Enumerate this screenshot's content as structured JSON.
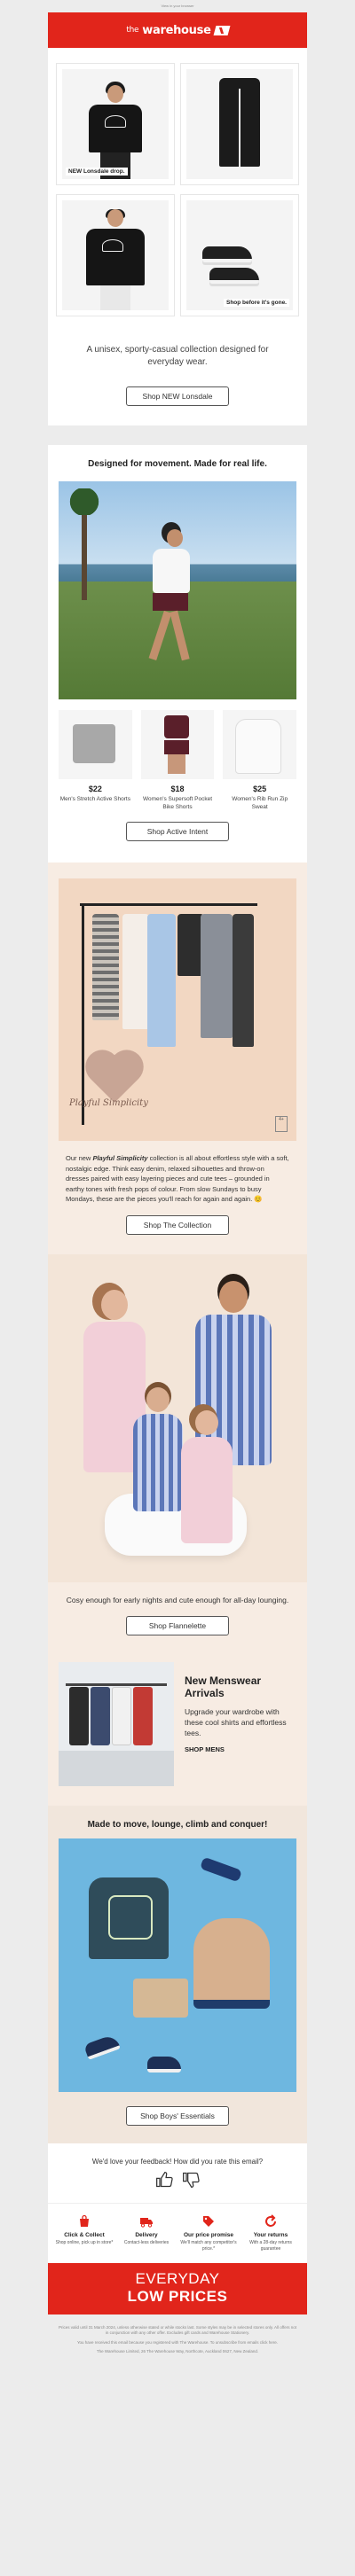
{
  "preheader": "View in your browser",
  "brand": {
    "name_the": "the",
    "name_main": "warehouse",
    "accent": "#e1251b"
  },
  "hero_grid": {
    "captions": [
      "NEW Lonsdale drop.",
      "Shop before it's gone."
    ],
    "tee_print": "LONSDALE"
  },
  "lonsdale": {
    "intro": "A unisex, sporty-casual collection designed for everyday wear.",
    "button": "Shop NEW Lonsdale"
  },
  "active": {
    "title": "Designed for movement. Made for real life.",
    "products": [
      {
        "price": "$22",
        "name": "Men's Stretch Active Shorts"
      },
      {
        "price": "$18",
        "name": "Women's Supersoft Pocket Bike Shorts"
      },
      {
        "price": "$25",
        "name": "Women's Rib Run Zip Sweat"
      }
    ],
    "button": "Shop Active Intent"
  },
  "playful": {
    "heart_text": "Playful Simplicity",
    "para_pre": "Our new ",
    "para_em": "Playful Simplicity",
    "para_post": " collection is all about effortless style with a soft, nostalgic edge. Think easy denim, relaxed silhouettes and throw-on dresses paired with easy layering pieces and cute tees – grounded in earthy tones with fresh pops of colour. From slow Sundays to busy Mondays, these are the pieces you'll reach for again and again. 😊",
    "button": "Shop The Collection"
  },
  "flannelette": {
    "caption": "Cosy enough for early nights and cute enough for all-day lounging.",
    "button": "Shop Flannelette"
  },
  "menswear": {
    "title": "New Menswear Arrivals",
    "body": "Upgrade your wardrobe with these cool shirts and effortless tees.",
    "link": "SHOP MENS"
  },
  "kids": {
    "title": "Made to move, lounge, climb and conquer!",
    "button": "Shop Boys' Essentials"
  },
  "feedback": {
    "question": "We'd love your feedback! How did you rate this email?"
  },
  "usps": [
    {
      "icon": "bag-icon",
      "title": "Click & Collect",
      "sub": "Shop online, pick up in store*"
    },
    {
      "icon": "truck-icon",
      "title": "Delivery",
      "sub": "Contact-less deliveries"
    },
    {
      "icon": "tag-icon",
      "title": "Our price promise",
      "sub": "We'll match any competitor's price.*"
    },
    {
      "icon": "return-icon",
      "title": "Your returns",
      "sub": "With a 28-day returns guarantee"
    }
  ],
  "elp": {
    "line1": "EVERYDAY",
    "line2": "LOW PRICES"
  },
  "footer": {
    "lines": [
      "Prices valid until 31 March 2024, unless otherwise stated or while stocks last. Some styles may be in selected stores only. All offers not in conjunction with any other offer. Excludes gift cards and Warehouse Stationery.",
      "You have received this email because you registered with The Warehouse. To unsubscribe from emails click here.",
      "The Warehouse Limited, 26 The Warehouse Way, Northcote, Auckland 0627, New Zealand."
    ]
  }
}
